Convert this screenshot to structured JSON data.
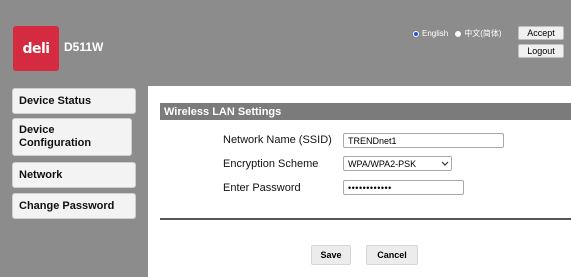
{
  "header": {
    "logo_text": "deli",
    "model": "D511W",
    "language": {
      "options": [
        {
          "label": "English",
          "selected": true
        },
        {
          "label": "中文(简体)",
          "selected": false
        }
      ]
    },
    "accept_label": "Accept",
    "logout_label": "Logout"
  },
  "sidebar": {
    "items": [
      {
        "label": "Device Status"
      },
      {
        "label": "Device Configuration"
      },
      {
        "label": "Network"
      },
      {
        "label": "Change Password"
      }
    ]
  },
  "main": {
    "section_title": "Wireless LAN Settings",
    "fields": {
      "ssid": {
        "label": "Network Name (SSID)",
        "value": "TRENDnet1"
      },
      "encryption": {
        "label": "Encryption Scheme",
        "value": "WPA/WPA2-PSK"
      },
      "password": {
        "label": "Enter Password",
        "value": "••••••••••••"
      }
    },
    "save_label": "Save",
    "cancel_label": "Cancel"
  },
  "colors": {
    "brand": "#d42b40",
    "chrome_gray": "#8c8c8c",
    "section_bar": "#7b7b7b",
    "radio_selected": "#1a5bd6"
  }
}
